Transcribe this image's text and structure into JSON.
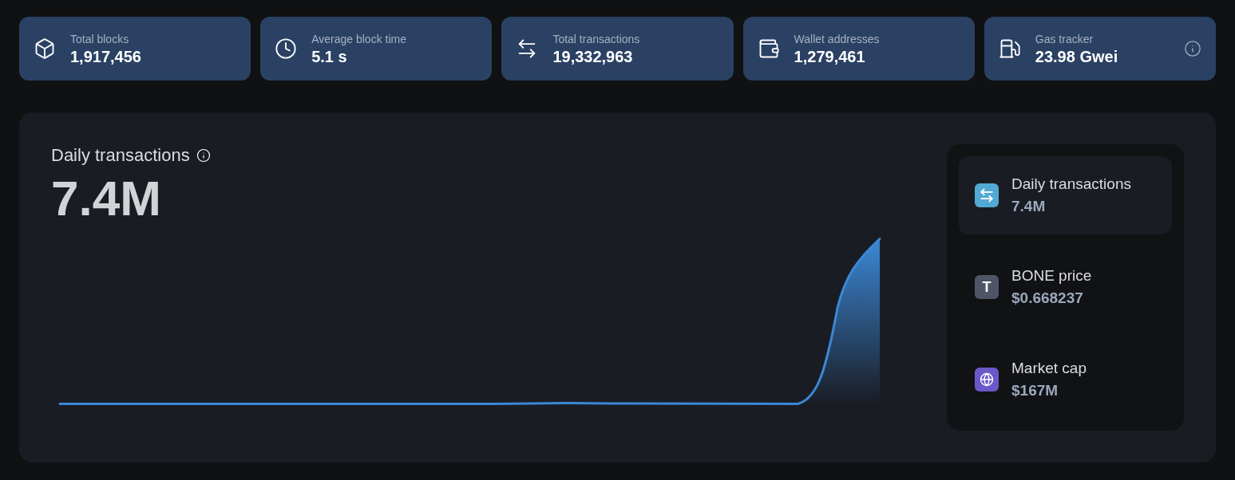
{
  "stats": [
    {
      "kind": "cube",
      "label": "Total blocks",
      "value": "1,917,456",
      "info": false
    },
    {
      "kind": "clock",
      "label": "Average block time",
      "value": "5.1 s",
      "info": false
    },
    {
      "kind": "swap",
      "label": "Total transactions",
      "value": "19,332,963",
      "info": false
    },
    {
      "kind": "wallet",
      "label": "Wallet addresses",
      "value": "1,279,461",
      "info": false
    },
    {
      "kind": "gas",
      "label": "Gas tracker",
      "value": "23.98 Gwei",
      "info": true
    }
  ],
  "chart_panel": {
    "title": "Daily transactions",
    "value": "7.4M"
  },
  "metrics": [
    {
      "kind": "swap",
      "label": "Daily transactions",
      "value": "7.4M",
      "selected": true,
      "color": "#52a9d4"
    },
    {
      "kind": "token",
      "label": "BONE price",
      "value": "$0.668237",
      "icon_text": "T",
      "selected": false,
      "color": "#4d5566"
    },
    {
      "kind": "globe",
      "label": "Market cap",
      "value": "$167M",
      "selected": false,
      "color": "#6b58c8"
    }
  ]
}
